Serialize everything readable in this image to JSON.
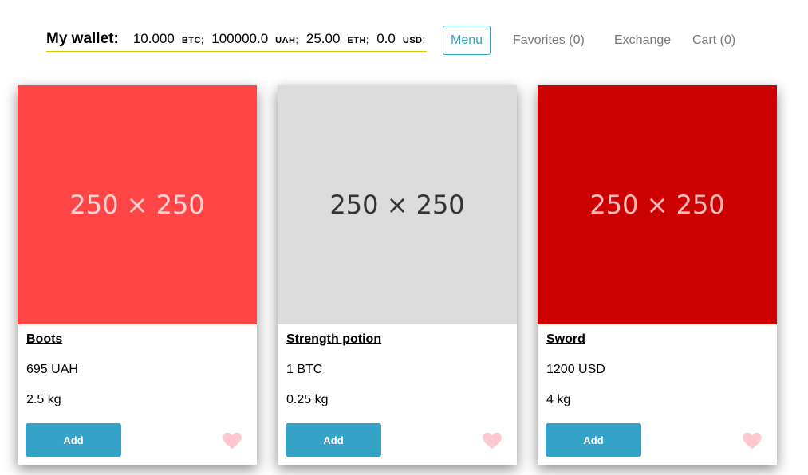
{
  "wallet": {
    "title": "My wallet:",
    "items": [
      {
        "amount": "10.000",
        "currency": "BTC",
        "sep": ";"
      },
      {
        "amount": "100000.0",
        "currency": "UAH",
        "sep": ";"
      },
      {
        "amount": "25.00",
        "currency": "ETH",
        "sep": ";"
      },
      {
        "amount": "0.0",
        "currency": "USD",
        "sep": ";"
      }
    ]
  },
  "nav": {
    "menu_label": "Menu",
    "favorites_label": "Favorites (0)",
    "exchange_label": "Exchange",
    "cart_label": "Cart (0)"
  },
  "products": [
    {
      "placeholder_text": "250 × 250",
      "image_bg": "#ff4545",
      "image_fg": "#ffd5d5",
      "name": "Boots",
      "price": "695 UAH",
      "weight": "2.5 kg",
      "add_label": "Add"
    },
    {
      "placeholder_text": "250 × 250",
      "image_bg": "#dcdcdc",
      "image_fg": "#333333",
      "name": "Strength potion",
      "price": "1 BTC",
      "weight": "0.25 kg",
      "add_label": "Add"
    },
    {
      "placeholder_text": "250 × 250",
      "image_bg": "#cc0000",
      "image_fg": "#ffbcbc",
      "name": "Sword",
      "price": "1200 USD",
      "weight": "4 kg",
      "add_label": "Add"
    }
  ],
  "colors": {
    "accent": "#35a2c8",
    "heart": "#ffc7cf",
    "underline": "#e6c200"
  },
  "icons": {
    "favorite": "heart-icon"
  }
}
